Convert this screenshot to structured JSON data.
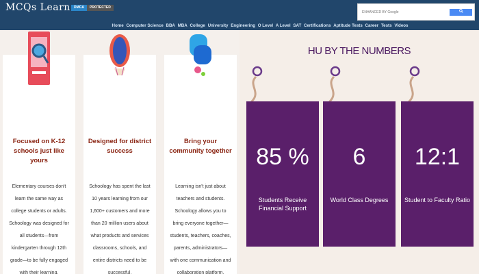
{
  "header": {
    "logo": "MCQs Learn",
    "badge_left": "DMCA",
    "badge_right": "PROTECTED",
    "search": {
      "placeholder": "ENHANCED BY Google"
    },
    "nav": [
      "Home",
      "Computer Science",
      "BBA",
      "MBA",
      "College",
      "University",
      "Engineering",
      "O Level",
      "A Level",
      "SAT",
      "Certifications",
      "Aptitude Tests",
      "Career",
      "Tests",
      "Videos"
    ]
  },
  "features": [
    {
      "title": "Focused on K-12 schools just like yours",
      "text": "Elementary courses don't learn the same way as college students or adults. Schoology was designed for all students—from kindergarten through 12th grade—to be fully engaged with their learning."
    },
    {
      "title": "Designed for district success",
      "text": "Schoology has spent the last 10 years learning from our 1,600+ customers and more than 20 million users about what products and services classrooms, schools, and entire districts need to be successful."
    },
    {
      "title": "Bring your community together",
      "text": "Learning isn't just about teachers and students. Schoology allows you to bring everyone together—students, teachers, coaches, parents, administrators—with one communication and collaboration platform."
    }
  ],
  "numbers": {
    "title": "HU BY THE NUMBERS",
    "stats": [
      {
        "value": "85 %",
        "label": "Students Receive Financial Support"
      },
      {
        "value": "6",
        "label": "World Class Degrees"
      },
      {
        "value": "12:1",
        "label": "Student to Faculty Ratio"
      }
    ]
  },
  "colors": {
    "header_bg": "#21466b",
    "heading_red": "#8a2412",
    "purple": "#5a1f6a"
  }
}
